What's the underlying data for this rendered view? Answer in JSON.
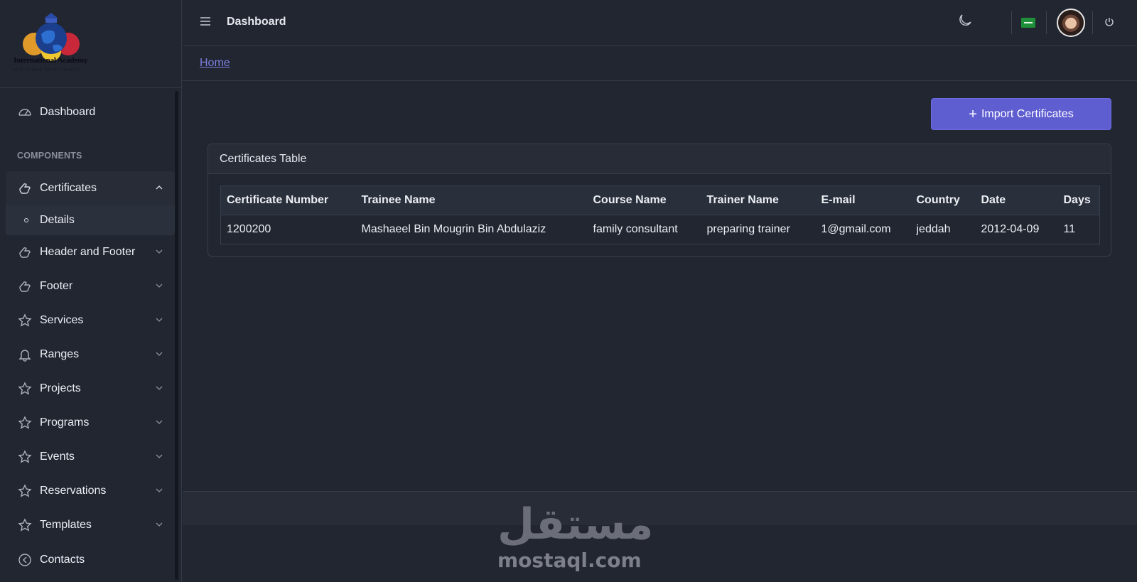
{
  "brand": {
    "name": "International Academy",
    "subtitle": "FOR HUMAN DEVELOPMENT"
  },
  "header": {
    "title": "Dashboard",
    "icons": [
      "menu-icon",
      "moon-icon",
      "saudi-flag-icon",
      "avatar",
      "power-icon"
    ]
  },
  "breadcrumb": {
    "home": "Home"
  },
  "sidebar": {
    "dashboard": "Dashboard",
    "section_title": "COMPONENTS",
    "certificates": "Certificates",
    "certificates_sub": "Details",
    "items": [
      {
        "label": "Header and Footer",
        "icon": "hand-icon"
      },
      {
        "label": "Footer",
        "icon": "hand-icon"
      },
      {
        "label": "Services",
        "icon": "star-icon"
      },
      {
        "label": "Ranges",
        "icon": "bell-icon"
      },
      {
        "label": "Projects",
        "icon": "star-icon"
      },
      {
        "label": "Programs",
        "icon": "star-icon"
      },
      {
        "label": "Events",
        "icon": "star-icon"
      },
      {
        "label": "Reservations",
        "icon": "star-icon"
      },
      {
        "label": "Templates",
        "icon": "star-icon"
      }
    ],
    "contacts": "Contacts"
  },
  "main": {
    "import_button": "Import Certificates",
    "card_title": "Certificates Table",
    "table": {
      "headers": [
        "Certificate Number",
        "Trainee Name",
        "Course Name",
        "Trainer Name",
        "E-mail",
        "Country",
        "Date",
        "Days"
      ],
      "rows": [
        [
          "1200200",
          "Mashaeel Bin Mougrin Bin Abdulaziz",
          "family consultant",
          "preparing trainer",
          "1@gmail.com",
          "jeddah",
          "2012-04-09",
          "11"
        ]
      ]
    }
  },
  "watermark": {
    "arabic": "مستقل",
    "latin": "mostaql.com"
  },
  "colors": {
    "background": "#212631",
    "accent": "#5f5ed1",
    "link": "#7c7fe0"
  }
}
